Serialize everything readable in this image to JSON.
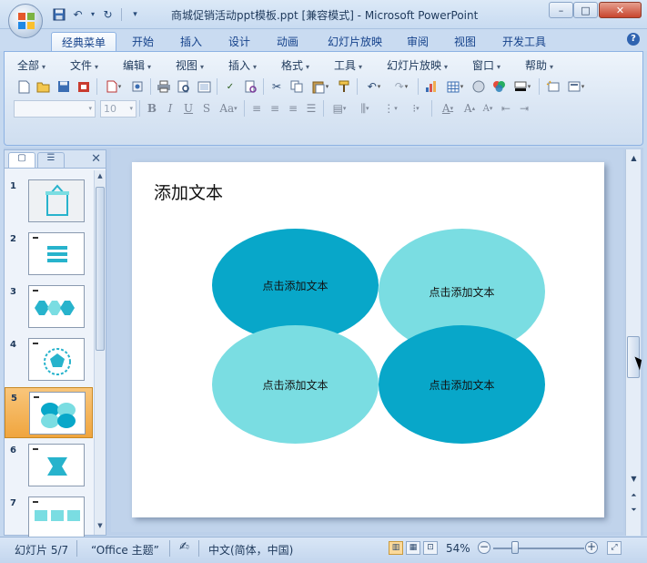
{
  "window": {
    "title": "商城促销活动ppt模板.ppt [兼容模式] - Microsoft PowerPoint",
    "controls": {
      "minimize": "–",
      "maximize": "□",
      "close": "✕"
    }
  },
  "ribbon_tabs": [
    "经典菜单",
    "开始",
    "插入",
    "设计",
    "动画",
    "幻灯片放映",
    "审阅",
    "视图",
    "开发工具"
  ],
  "classic_menu": [
    "全部",
    "文件",
    "编辑",
    "视图",
    "插入",
    "格式",
    "工具",
    "幻灯片放映",
    "窗口",
    "帮助"
  ],
  "font": {
    "size": "10"
  },
  "slide_panel": {
    "slides": [
      {
        "num": "1"
      },
      {
        "num": "2"
      },
      {
        "num": "3"
      },
      {
        "num": "4"
      },
      {
        "num": "5",
        "selected": true
      },
      {
        "num": "6"
      },
      {
        "num": "7"
      }
    ]
  },
  "slide": {
    "title": "添加文本",
    "ellipses": [
      {
        "label": "点击添加文本",
        "color": "#08a7c9"
      },
      {
        "label": "点击添加文本",
        "color": "#7adde2"
      },
      {
        "label": "点击添加文本",
        "color": "#7adde2"
      },
      {
        "label": "点击添加文本",
        "color": "#08a7c9"
      }
    ]
  },
  "status": {
    "slide_counter": "幻灯片 5/7",
    "theme": "“Office 主题”",
    "language": "中文(简体，中国)",
    "zoom": "54%"
  },
  "colors": {
    "accent_dark": "#08a7c9",
    "accent_light": "#7adde2",
    "ribbon_text": "#15428b"
  }
}
